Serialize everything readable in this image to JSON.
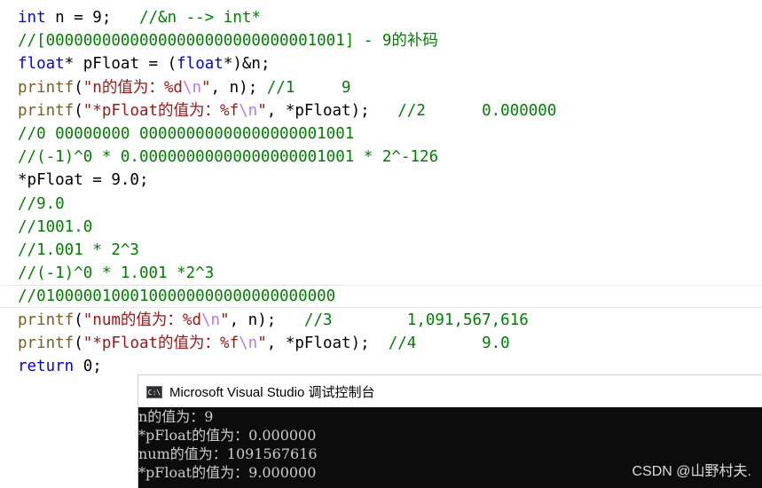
{
  "editor": {
    "lines": [
      [
        {
          "c": "kw",
          "t": "int"
        },
        {
          "c": "id",
          "t": " n = 9;   "
        },
        {
          "c": "cm",
          "t": "//&n --> int*"
        }
      ],
      [
        {
          "c": "cm",
          "t": "//[00000000000000000000000000001001] - 9的补码"
        }
      ],
      [
        {
          "c": "kw",
          "t": "float"
        },
        {
          "c": "id",
          "t": "* pFloat = ("
        },
        {
          "c": "kw",
          "t": "float"
        },
        {
          "c": "id",
          "t": "*)&n;"
        }
      ],
      [
        {
          "c": "fn",
          "t": "printf"
        },
        {
          "c": "id",
          "t": "("
        },
        {
          "c": "st",
          "t": "\"n的值为：%d"
        },
        {
          "c": "esc",
          "t": "\\n"
        },
        {
          "c": "st",
          "t": "\""
        },
        {
          "c": "id",
          "t": ", n); "
        },
        {
          "c": "cm",
          "t": "//1     9"
        }
      ],
      [
        {
          "c": "fn",
          "t": "printf"
        },
        {
          "c": "id",
          "t": "("
        },
        {
          "c": "st",
          "t": "\"*pFloat的值为：%f"
        },
        {
          "c": "esc",
          "t": "\\n"
        },
        {
          "c": "st",
          "t": "\""
        },
        {
          "c": "id",
          "t": ", *pFloat);   "
        },
        {
          "c": "cm",
          "t": "//2      0.000000"
        }
      ],
      [
        {
          "c": "cm",
          "t": "//0 00000000 00000000000000000001001"
        }
      ],
      [
        {
          "c": "cm",
          "t": "//(-1)^0 * 0.00000000000000000001001 * 2^-126"
        }
      ],
      [
        {
          "c": "id",
          "t": "*pFloat = 9.0;"
        }
      ],
      [
        {
          "c": "cm",
          "t": "//9.0"
        }
      ],
      [
        {
          "c": "cm",
          "t": "//1001.0"
        }
      ],
      [
        {
          "c": "cm",
          "t": "//1.001 * 2^3"
        }
      ],
      [
        {
          "c": "cm",
          "t": "//(-1)^0 * 1.001 *2^3"
        }
      ],
      [
        {
          "c": "cm",
          "t": "//01000001000100000000000000000000"
        }
      ],
      [
        {
          "c": "fn",
          "t": "printf"
        },
        {
          "c": "id",
          "t": "("
        },
        {
          "c": "st",
          "t": "\"num的值为：%d"
        },
        {
          "c": "esc",
          "t": "\\n"
        },
        {
          "c": "st",
          "t": "\""
        },
        {
          "c": "id",
          "t": ", n);   "
        },
        {
          "c": "cm",
          "t": "//3        1,091,567,616"
        }
      ],
      [
        {
          "c": "fn",
          "t": "printf"
        },
        {
          "c": "id",
          "t": "("
        },
        {
          "c": "st",
          "t": "\"*pFloat的值为：%f"
        },
        {
          "c": "esc",
          "t": "\\n"
        },
        {
          "c": "st",
          "t": "\""
        },
        {
          "c": "id",
          "t": ", *pFloat);  "
        },
        {
          "c": "cm",
          "t": "//4       9.0"
        }
      ],
      [
        {
          "c": "kw",
          "t": "return"
        },
        {
          "c": "id",
          "t": " 0;"
        }
      ]
    ],
    "current_line_index": 12
  },
  "console": {
    "icon_text": "C:\\",
    "title": "Microsoft Visual Studio 调试控制台",
    "output": [
      "n的值为：9",
      "*pFloat的值为：0.000000",
      "num的值为：1091567616",
      "*pFloat的值为：9.000000"
    ],
    "background": "#0c0c0c",
    "text_color": "#cccccc"
  },
  "watermark": "CSDN @山野村夫."
}
